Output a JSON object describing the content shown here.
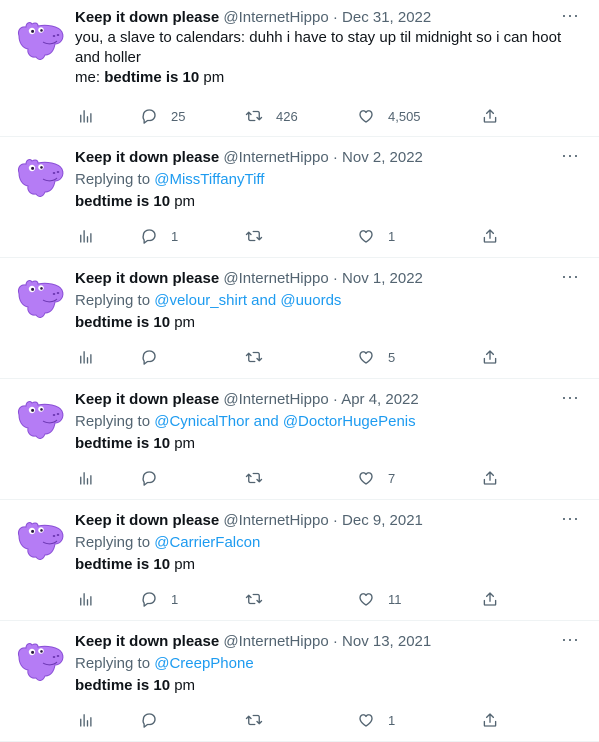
{
  "tweets": [
    {
      "name": "Keep it down please",
      "handle": "@InternetHippo",
      "sep": "·",
      "date": "Dec 31, 2022",
      "text1": "you, a slave to calendars: duhh i have to stay up til midnight so i can hoot",
      "text2": "and holler",
      "me": "me: ",
      "bold": "bedtime is 10",
      "tail": " pm",
      "replies": "25",
      "retweets": "426",
      "likes": "4,505"
    },
    {
      "name": "Keep it down please",
      "handle": "@InternetHippo",
      "sep": "·",
      "date": "Nov 2, 2022",
      "replying_prefix": "Replying to ",
      "replying_to": "@MissTiffanyTiff",
      "bold": "bedtime is 10",
      "tail": " pm",
      "replies": "1",
      "retweets": "",
      "likes": "1"
    },
    {
      "name": "Keep it down please",
      "handle": "@InternetHippo",
      "sep": "·",
      "date": "Nov 1, 2022",
      "replying_prefix": "Replying to ",
      "replying_to": "@velour_shirt and @uuords",
      "bold": "bedtime is 10",
      "tail": " pm",
      "replies": "",
      "retweets": "",
      "likes": "5"
    },
    {
      "name": "Keep it down please",
      "handle": "@InternetHippo",
      "sep": "·",
      "date": "Apr 4, 2022",
      "replying_prefix": "Replying to ",
      "replying_to": "@CynicalThor and @DoctorHugePenis",
      "bold": "bedtime is 10",
      "tail": " pm",
      "replies": "",
      "retweets": "",
      "likes": "7"
    },
    {
      "name": "Keep it down please",
      "handle": "@InternetHippo",
      "sep": "·",
      "date": "Dec 9, 2021",
      "replying_prefix": "Replying to ",
      "replying_to": "@CarrierFalcon",
      "bold": "bedtime is 10",
      "tail": " pm",
      "replies": "1",
      "retweets": "",
      "likes": "11"
    },
    {
      "name": "Keep it down please",
      "handle": "@InternetHippo",
      "sep": "·",
      "date": "Nov 13, 2021",
      "replying_prefix": "Replying to ",
      "replying_to": "@CreepPhone",
      "bold": "bedtime is 10",
      "tail": " pm",
      "replies": "",
      "retweets": "",
      "likes": "1"
    }
  ],
  "icons": {
    "more": "more-icon",
    "views": "analytics-icon",
    "reply": "reply-icon",
    "retweet": "retweet-icon",
    "like": "heart-icon",
    "share": "share-icon"
  },
  "colors": {
    "link": "#1d9bf0",
    "muted": "#536471",
    "text": "#0f1419",
    "avatar": "#b57cf5"
  }
}
